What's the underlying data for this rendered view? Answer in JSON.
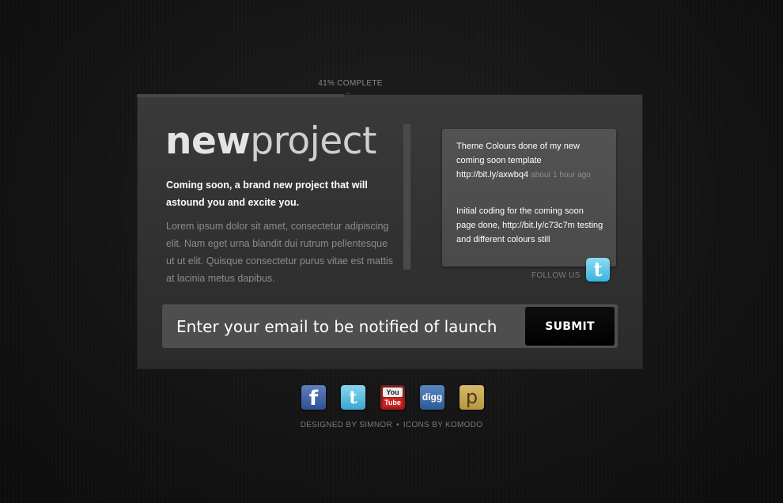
{
  "progress": {
    "label": "41% COMPLETE",
    "percent": 41
  },
  "logo": {
    "bold": "new",
    "light": "project"
  },
  "intro": {
    "tagline": "Coming soon, a brand new project that will astound you and excite you.",
    "body": "Lorem ipsum dolor sit amet, consectetur adipiscing elit. Nam eget urna blandit dui rutrum pellentesque ut ut elit. Quisque consectetur purus vitae est mattis at lacinia metus dapibus."
  },
  "tweets": [
    {
      "text": "Theme Colours done of my new coming soon template http://bit.ly/axwbq4",
      "time": "about 1 hour ago"
    },
    {
      "text": "Initial coding for the coming soon page done, http://bit.ly/c73c7m testing and different colours still",
      "time": ""
    }
  ],
  "follow": {
    "label": "FOLLOW US",
    "icon": "twitter-icon"
  },
  "signup": {
    "placeholder": "Enter your email to be notified of launch",
    "submit_label": "SUBMIT"
  },
  "social_icons": [
    {
      "name": "facebook-icon",
      "glyph": "f"
    },
    {
      "name": "twitter-icon",
      "glyph": "t"
    },
    {
      "name": "youtube-icon",
      "top": "You",
      "bottom": "Tube"
    },
    {
      "name": "digg-icon",
      "glyph": "digg"
    },
    {
      "name": "posterous-icon",
      "glyph": "p"
    }
  ],
  "credits": {
    "designed": "DESIGNED BY SIMNOR",
    "separator": "•",
    "icons": "ICONS BY KOMODO"
  },
  "colors": {
    "background": "#121212",
    "panel": "#353535",
    "input_bg": "#4e4e4e",
    "button_bg": "#000000",
    "twitter_blue": "#39b3dc"
  }
}
